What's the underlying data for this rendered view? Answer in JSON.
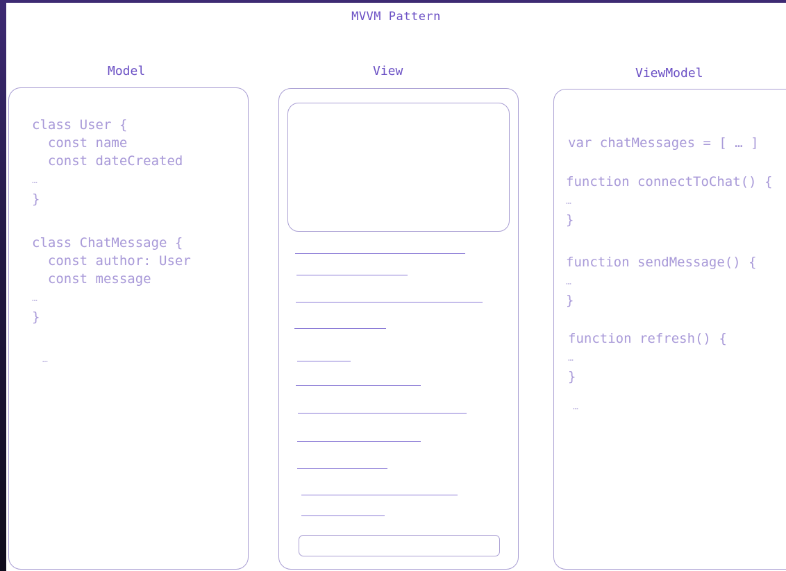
{
  "title": "MVVM Pattern",
  "columns": {
    "model": "Model",
    "view": "View",
    "viewmodel": "ViewModel"
  },
  "model_code": {
    "user_class": "class User {",
    "user_name": "  const name",
    "user_date": "  const dateCreated",
    "user_ellipsis": "…",
    "user_close": "}",
    "chat_class": "class ChatMessage {",
    "chat_author": "  const author: User",
    "chat_message": "  const message",
    "chat_ellipsis": "…",
    "chat_close": "}",
    "more": "…"
  },
  "viewmodel_code": {
    "var_line": "var chatMessages = [ … ]",
    "fn_connect": "function connectToChat() {",
    "connect_ellipsis": "…",
    "connect_close": "}",
    "fn_send": "function sendMessage() {",
    "send_ellipsis": "…",
    "send_close": "}",
    "fn_refresh": "function refresh() {",
    "refresh_ellipsis": "…",
    "refresh_close": "}",
    "more": "…"
  },
  "colors": {
    "accent": "#6a4fc4",
    "code": "#a899d8",
    "border": "#a99ed3",
    "line": "#8a7ad6"
  }
}
